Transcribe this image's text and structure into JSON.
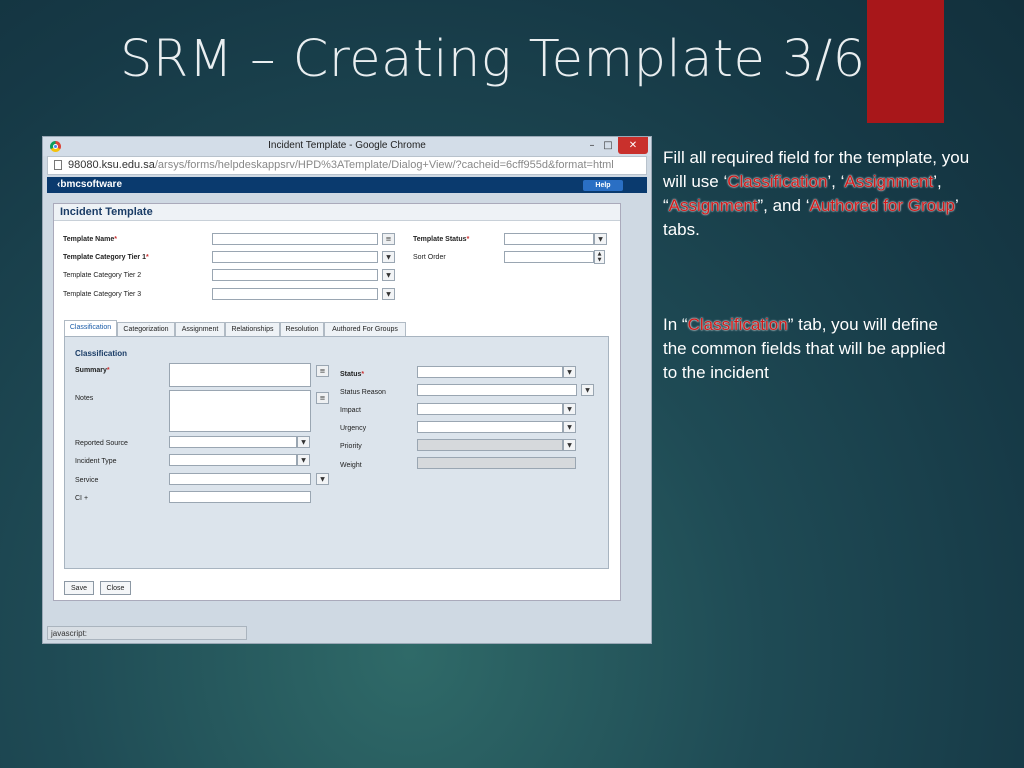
{
  "slide": {
    "title": "SRM – Creating Template 3/6",
    "p1_a": "Fill all required field for the template, you will use ‘",
    "p1_hl1": "Classification",
    "p1_b": "’, ‘",
    "p1_hl2": "Assignment",
    "p1_c": "’, “",
    "p1_hl3": "Assignment",
    "p1_d": "”, and ‘",
    "p1_hl4": "Authored for Group",
    "p1_e": "’ tabs.",
    "p2_a": "In “",
    "p2_hl": "Classification",
    "p2_b": "” tab, you will define the common fields that will be applied to the incident",
    "accent_color": "#a8171a",
    "highlight_color": "#d21a1a"
  },
  "browser": {
    "window_title": "Incident Template - Google Chrome",
    "min_glyph": "–",
    "max_glyph": "□",
    "close_glyph": "✕",
    "url_host": "98080.ksu.edu.sa",
    "url_path": "/arsys/forms/helpdeskappsrv/HPD%3ATemplate/Dialog+View/?cacheid=6cff955d&format=html",
    "brand": "‹bmcsoftware",
    "help_label": "Help",
    "status_text": "javascript:"
  },
  "form": {
    "header": "Incident Template",
    "template_name": "Template Name",
    "template_status": "Template Status",
    "tier1": "Template Category Tier 1",
    "sort_order": "Sort Order",
    "tier2": "Template Category Tier 2",
    "tier3": "Template Category Tier 3",
    "req_mark": "*",
    "menu_glyph": "≡",
    "arrow_glyph": "▼",
    "spin_up": "▲",
    "spin_down": "▼",
    "tabs": [
      "Classification",
      "Categorization",
      "Assignment",
      "Relationships",
      "Resolution",
      "Authored For Groups"
    ],
    "section": "Classification",
    "summary": "Summary",
    "notes": "Notes",
    "reported_source": "Reported Source",
    "incident_type": "Incident Type",
    "service": "Service",
    "ci": "CI +",
    "status": "Status",
    "status_reason": "Status Reason",
    "impact": "Impact",
    "urgency": "Urgency",
    "priority": "Priority",
    "weight": "Weight",
    "save": "Save",
    "close": "Close"
  }
}
